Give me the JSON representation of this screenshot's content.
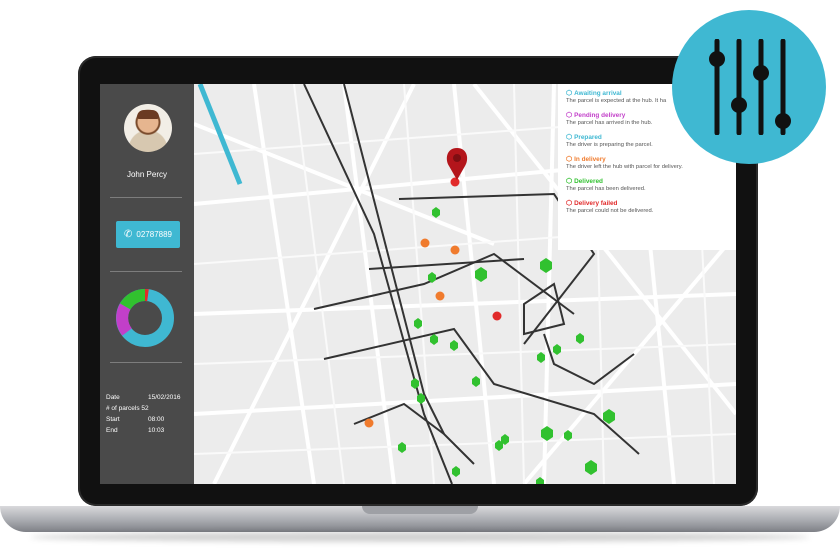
{
  "sidebar": {
    "user_name": "John Percy",
    "phone": "02787889",
    "stats": [
      {
        "label": "Date",
        "value": "15/02/2016"
      },
      {
        "label": "# of parcels",
        "value": "52"
      },
      {
        "label": "Start",
        "value": "08:00"
      },
      {
        "label": "End",
        "value": "10:03"
      }
    ]
  },
  "legend": [
    {
      "title": "Awaiting arrival",
      "desc": "The parcel is expected at the hub. It ha",
      "color": "#3fb8d2"
    },
    {
      "title": "Pending delivery",
      "desc": "The parcel has arrived in the hub.",
      "color": "#c23fc9"
    },
    {
      "title": "Prepared",
      "desc": "The driver is preparing the parcel.",
      "color": "#3fb8d2"
    },
    {
      "title": "In delivery",
      "desc": "The driver left the hub with parcel for delivery.",
      "color": "#f07b2d"
    },
    {
      "title": "Delivered",
      "desc": "The parcel has been delivered.",
      "color": "#31c12f"
    },
    {
      "title": "Delivery failed",
      "desc": "The parcel could not be delivered.",
      "color": "#e12a2a"
    }
  ],
  "icons": {
    "phone": "phone-icon",
    "legend": "box-icon",
    "badge": "sliders-icon",
    "pin": "map-pin-icon"
  }
}
